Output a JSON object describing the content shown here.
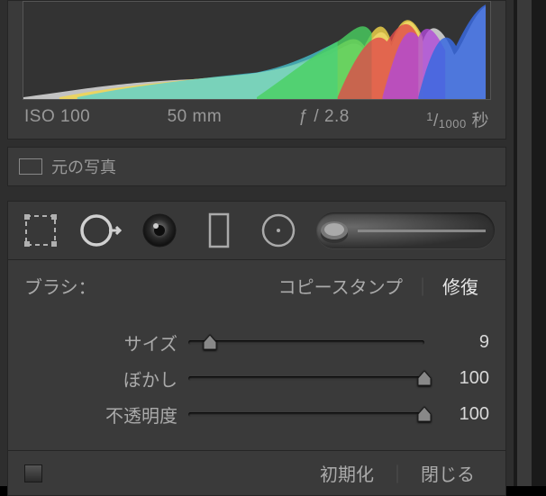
{
  "exif": {
    "iso": "ISO 100",
    "focal": "50 mm",
    "aperture": "ƒ / 2.8",
    "shutter_num": "1",
    "shutter_den": "1000",
    "shutter_unit": "秒"
  },
  "preview": {
    "label": "元の写真"
  },
  "brush": {
    "label": "ブラシ：",
    "mode_clone": "コピースタンプ",
    "mode_heal": "修復",
    "active_mode": "heal"
  },
  "sliders": {
    "size": {
      "label": "サイズ",
      "value": 9,
      "max": 100
    },
    "feather": {
      "label": "ぼかし",
      "value": 100,
      "max": 100
    },
    "opacity": {
      "label": "不透明度",
      "value": 100,
      "max": 100
    }
  },
  "footer": {
    "reset": "初期化",
    "close": "閉じる"
  },
  "icons": {
    "crop": "crop-icon",
    "spot": "spot-removal-icon",
    "redeye": "redeye-icon",
    "grad": "graduated-filter-icon",
    "radial": "radial-filter-icon",
    "brush": "brush-icon"
  }
}
